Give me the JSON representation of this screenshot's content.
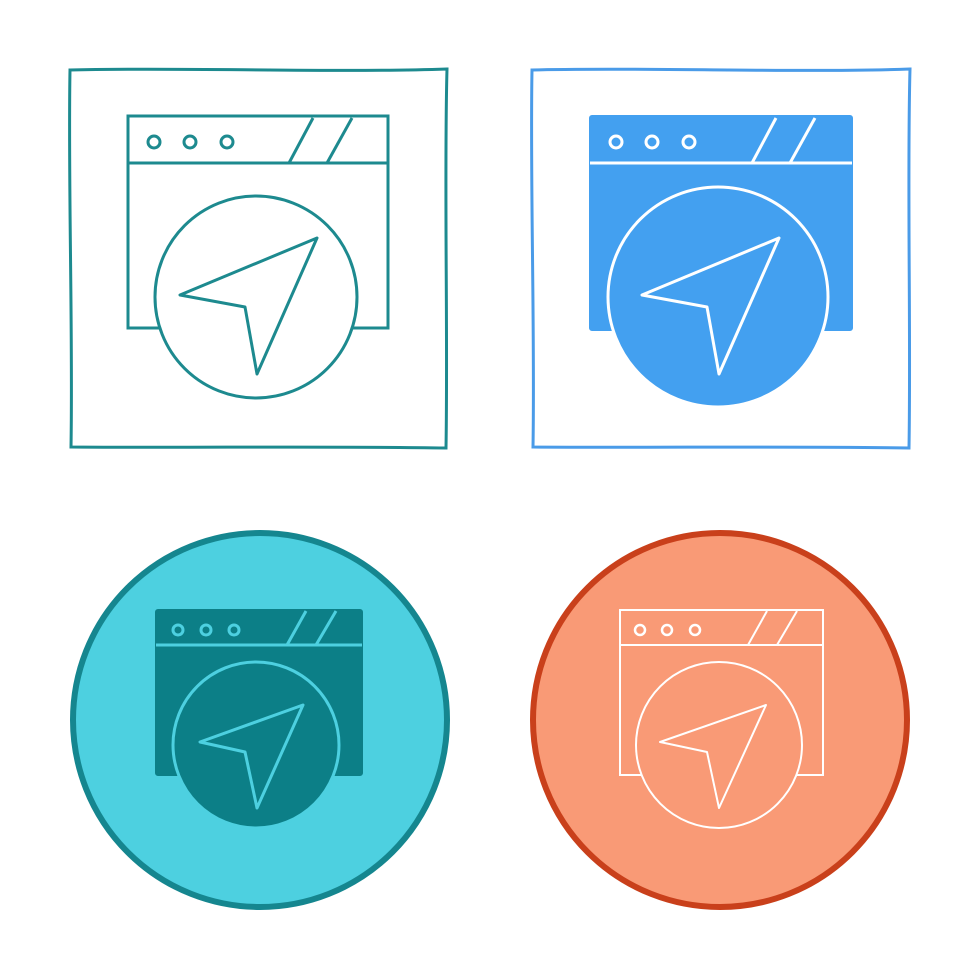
{
  "icons": [
    {
      "id": "outline",
      "style": "line",
      "semantic": "browser-navigation-icon",
      "frame": "square",
      "colors": {
        "frame_stroke": "#1d8a8f",
        "frame_fill": "#ffffff",
        "window_fill": "none",
        "window_stroke": "#1d8a8f",
        "circle_fill": "#ffffff",
        "circle_stroke": "#1d8a8f",
        "arrow_fill": "none",
        "arrow_stroke": "#1d8a8f",
        "dots_stroke": "#1d8a8f",
        "slash_stroke": "#1d8a8f"
      }
    },
    {
      "id": "glyph",
      "style": "solid",
      "semantic": "browser-navigation-icon",
      "frame": "square",
      "colors": {
        "frame_stroke": "#4a9be8",
        "frame_fill": "#ffffff",
        "window_fill": "#43a0f0",
        "window_stroke": "#43a0f0",
        "circle_fill": "#43a0f0",
        "circle_stroke": "#ffffff",
        "arrow_fill": "none",
        "arrow_stroke": "#ffffff",
        "dots_stroke": "#ffffff",
        "slash_stroke": "#ffffff"
      }
    },
    {
      "id": "flat-teal",
      "style": "flat",
      "semantic": "browser-navigation-icon",
      "frame": "circle",
      "colors": {
        "frame_stroke": "#15868f",
        "frame_fill": "#4dd0e0",
        "window_fill": "#0c7f87",
        "window_stroke": "#0c7f87",
        "circle_fill": "#0c7f87",
        "circle_stroke": "#4dd0e0",
        "arrow_fill": "none",
        "arrow_stroke": "#4dd0e0",
        "dots_stroke": "#4dd0e0",
        "slash_stroke": "#4dd0e0"
      }
    },
    {
      "id": "flat-orange",
      "style": "flat-outline",
      "semantic": "browser-navigation-icon",
      "frame": "circle",
      "colors": {
        "frame_stroke": "#c9401b",
        "frame_fill": "#f99a76",
        "window_fill": "none",
        "window_stroke": "#ffffff",
        "circle_fill": "#f99a76",
        "circle_stroke": "#ffffff",
        "arrow_fill": "none",
        "arrow_stroke": "#ffffff",
        "dots_stroke": "#ffffff",
        "slash_stroke": "#ffffff"
      }
    }
  ]
}
